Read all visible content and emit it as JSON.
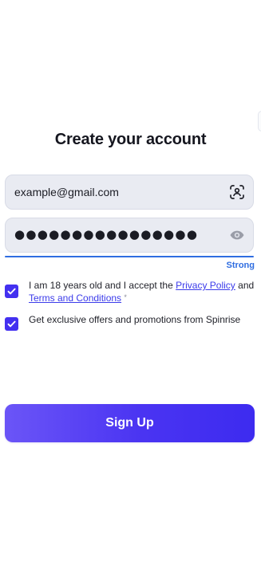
{
  "form": {
    "title": "Create your account",
    "email": {
      "value": "example@gmail.com",
      "icon": "face-id-scan-icon"
    },
    "password": {
      "value": "●●●●●●●●●●●●●●●●",
      "icon": "eye-icon",
      "strength_label": "Strong",
      "strength_color": "#2f6de1"
    },
    "terms": {
      "checked": true,
      "text_before": "I am 18 years old and I accept the",
      "privacy_link": "Privacy Policy",
      "and_text": "and",
      "terms_link": "Terms and Conditions",
      "required_mark": "*"
    },
    "offers": {
      "checked": true,
      "text": "Get exclusive offers and promotions from Spinrise"
    },
    "submit_label": "Sign Up"
  },
  "colors": {
    "accent": "#4330f0",
    "button_gradient_start": "#6b55f7",
    "button_gradient_end": "#3d2bf0",
    "field_background": "#e9ebf2",
    "link": "#3b3bea"
  }
}
